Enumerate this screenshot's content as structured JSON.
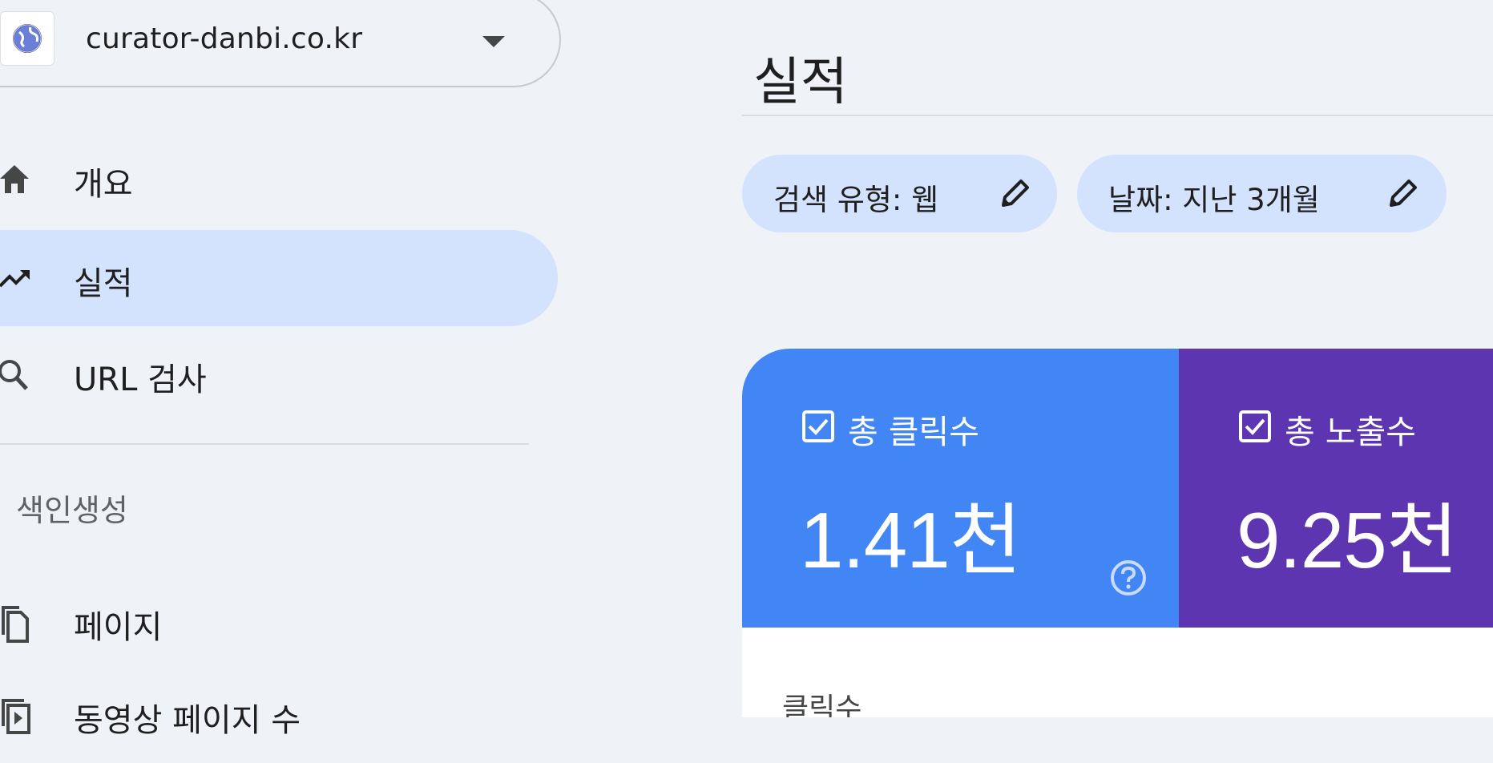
{
  "property": {
    "name": "curator-danbi.co.kr"
  },
  "nav": {
    "items": [
      {
        "label": "개요",
        "icon": "home-icon",
        "active": false
      },
      {
        "label": "실적",
        "icon": "trending-up-icon",
        "active": true
      },
      {
        "label": "URL 검사",
        "icon": "search-icon",
        "active": false
      }
    ],
    "section_header": "색인생성",
    "section_items": [
      {
        "label": "페이지",
        "icon": "pages-icon"
      },
      {
        "label": "동영상 페이지 수",
        "icon": "video-pages-icon"
      }
    ]
  },
  "main": {
    "title": "실적",
    "filters": [
      {
        "label": "검색 유형: 웹",
        "icon": "pencil-icon"
      },
      {
        "label": "날짜: 지난 3개월",
        "icon": "pencil-icon"
      }
    ],
    "metrics": [
      {
        "label": "총 클릭수",
        "value": "1.41천",
        "checked": true,
        "color": "#4285f4"
      },
      {
        "label": "총 노출수",
        "value": "9.25천",
        "checked": true,
        "color": "#5e35b1"
      }
    ],
    "chart_axis_label": "클릭수"
  },
  "colors": {
    "background": "#eff2f7",
    "active_nav": "#d3e3fd",
    "chip": "#d3e3fd",
    "clicks": "#4285f4",
    "impressions": "#5e35b1"
  }
}
